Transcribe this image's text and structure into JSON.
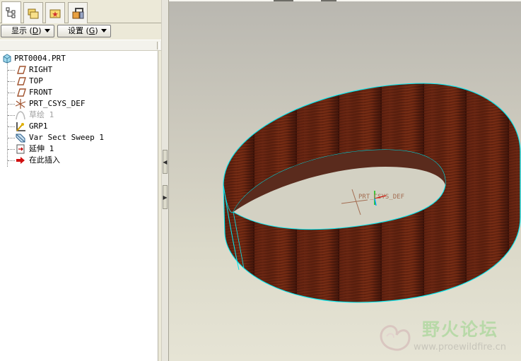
{
  "navigator": {
    "tabs": [
      {
        "icon": "model-tree-icon",
        "active": true
      },
      {
        "icon": "folder-browser-icon",
        "active": false
      },
      {
        "icon": "favorites-icon",
        "active": false
      },
      {
        "icon": "connections-icon",
        "active": false
      }
    ],
    "show_button": "显示",
    "show_mnemonic": "D",
    "settings_button": "设置",
    "settings_mnemonic": "G",
    "tree": {
      "root": "PRT0004.PRT",
      "items": [
        {
          "label": "RIGHT",
          "icon": "datum-plane-icon",
          "suppressed": false
        },
        {
          "label": "TOP",
          "icon": "datum-plane-icon",
          "suppressed": false
        },
        {
          "label": "FRONT",
          "icon": "datum-plane-icon",
          "suppressed": false
        },
        {
          "label": "PRT_CSYS_DEF",
          "icon": "coordinate-system-icon",
          "suppressed": false
        },
        {
          "label": "草绘 1",
          "icon": "sketch-icon",
          "suppressed": true
        },
        {
          "label": "GRP1",
          "icon": "group-icon",
          "suppressed": false
        },
        {
          "label": "Var Sect Sweep 1",
          "icon": "sweep-icon",
          "suppressed": false
        },
        {
          "label": "延伸 1",
          "icon": "extend-icon",
          "suppressed": false
        },
        {
          "label": "在此插入",
          "icon": "insert-here-icon",
          "suppressed": false
        }
      ]
    }
  },
  "viewport": {
    "csys_label": "PRT_CSYS_DEF",
    "model_color": "#5a1f0e",
    "edge_color": "#00ffff"
  },
  "watermark": {
    "title": "野火论坛",
    "url": "www.proewildfire.cn"
  }
}
